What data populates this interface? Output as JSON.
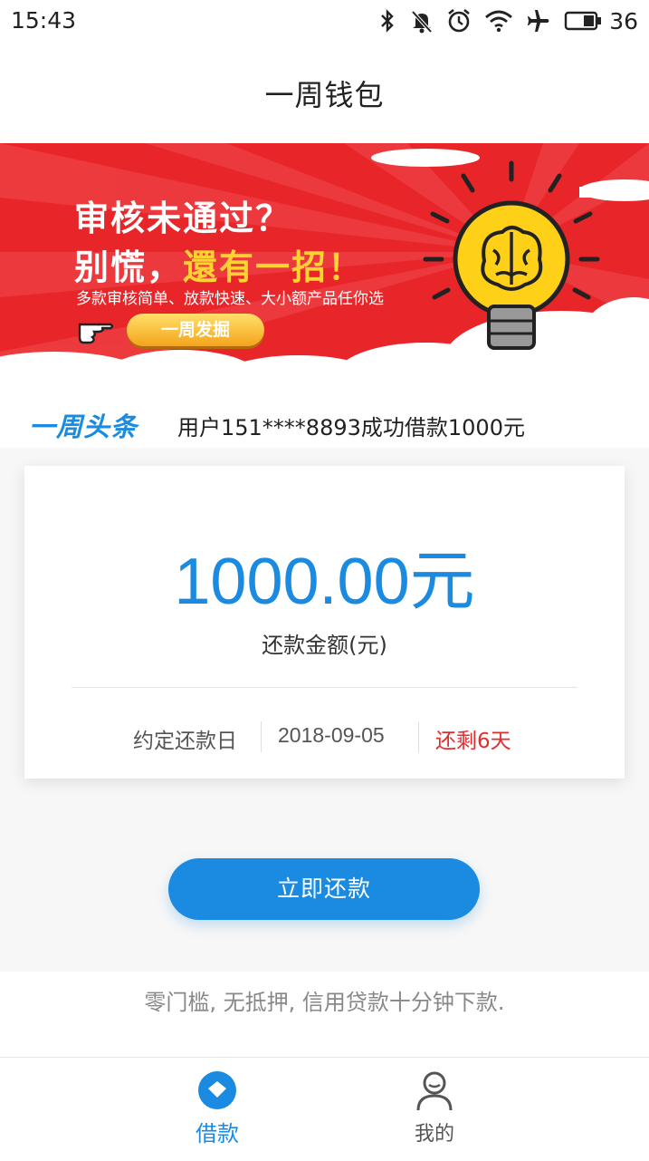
{
  "status_bar": {
    "time": "15:43",
    "battery": "36",
    "icons": [
      "bluetooth-icon",
      "mute-icon",
      "alarm-icon",
      "wifi-icon",
      "airplane-icon",
      "battery-icon"
    ]
  },
  "header": {
    "title": "一周钱包"
  },
  "banner": {
    "line1": "审核未通过？",
    "line2_prefix": "别慌，",
    "line2_highlight": "還有一招！",
    "subtitle": "多款审核简单、放款快速、大小额产品任你选",
    "button_label": "一周发掘",
    "background_color": "#e8262a",
    "highlight_color": "#ffd234"
  },
  "ticker": {
    "label": "一周头条",
    "message": "用户151****8893成功借款1000元"
  },
  "repayment": {
    "amount": "1000.00元",
    "amount_label": "还款金额(元)",
    "due_label": "约定还款日",
    "due_date": "2018-09-05",
    "remaining": "还剩6天"
  },
  "actions": {
    "pay_label": "立即还款"
  },
  "slogan": "零门槛, 无抵押, 信用贷款十分钟下款.",
  "tabbar": {
    "items": [
      {
        "label": "借款",
        "icon": "loan-icon",
        "active": true
      },
      {
        "label": "我的",
        "icon": "user-icon",
        "active": false
      }
    ]
  },
  "colors": {
    "accent": "#1a8be0",
    "warning": "#e02e2e"
  }
}
